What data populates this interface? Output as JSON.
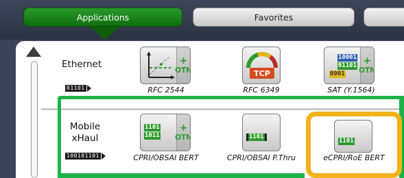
{
  "tabs": [
    {
      "label": "Applications",
      "selected": true
    },
    {
      "label": "Favorites",
      "selected": false
    },
    {
      "label": "",
      "selected": false
    }
  ],
  "categories": [
    {
      "label": "Ethernet",
      "code": "01101",
      "apps": [
        {
          "caption": "RFC 2544",
          "icon": "rfc2544-chart-icon",
          "otn": true
        },
        {
          "caption": "RFC 6349",
          "icon": "tcp-gauge-icon",
          "otn": false,
          "icon_text": "TCP"
        },
        {
          "caption": "SAT (Y.1564)",
          "icon": "sat-bits-icon",
          "otn": true,
          "bits": [
            "10001",
            "01101",
            "0001"
          ]
        }
      ]
    },
    {
      "label": "Mobile\nxHaul",
      "label_line1": "Mobile",
      "label_line2": "xHaul",
      "code": "100101101",
      "apps": [
        {
          "caption": "CPRI/OBSAI BERT",
          "icon": "cpri-bert-bits-icon",
          "otn": true,
          "bits": [
            "1101",
            "1011"
          ]
        },
        {
          "caption": "CPRI/OBSAI P.Thru",
          "icon": "cpri-passthru-bits-icon",
          "otn": false,
          "bits": [
            "1101"
          ]
        },
        {
          "caption": "eCPRI/RoE BERT",
          "icon": "ecpri-bits-icon",
          "otn": false,
          "bits": [
            "1101"
          ]
        }
      ]
    }
  ],
  "otn_label": "OTN",
  "plus_label": "+",
  "colors": {
    "tab_selected": "#1a8a1a",
    "highlight_green": "#1eb34a",
    "highlight_yellow": "#f2b21b",
    "otn_green": "#2a9a2a"
  }
}
